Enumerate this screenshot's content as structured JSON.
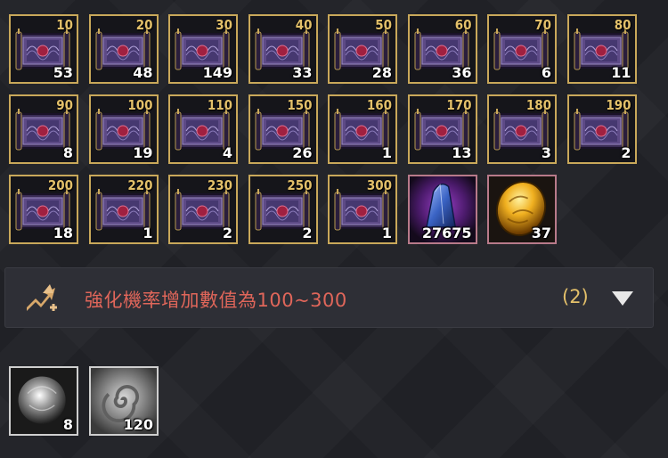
{
  "scrolls": [
    {
      "level": "10",
      "count": "53"
    },
    {
      "level": "20",
      "count": "48"
    },
    {
      "level": "30",
      "count": "149"
    },
    {
      "level": "40",
      "count": "33"
    },
    {
      "level": "50",
      "count": "28"
    },
    {
      "level": "60",
      "count": "36"
    },
    {
      "level": "70",
      "count": "6"
    },
    {
      "level": "80",
      "count": "11"
    },
    {
      "level": "90",
      "count": "8"
    },
    {
      "level": "100",
      "count": "19"
    },
    {
      "level": "110",
      "count": "4"
    },
    {
      "level": "150",
      "count": "26"
    },
    {
      "level": "160",
      "count": "1"
    },
    {
      "level": "170",
      "count": "13"
    },
    {
      "level": "180",
      "count": "3"
    },
    {
      "level": "190",
      "count": "2"
    },
    {
      "level": "200",
      "count": "18"
    },
    {
      "level": "220",
      "count": "1"
    },
    {
      "level": "230",
      "count": "2"
    },
    {
      "level": "250",
      "count": "2"
    },
    {
      "level": "300",
      "count": "1"
    }
  ],
  "materials": [
    {
      "name": "blue-crystal-icon",
      "count": "27675"
    },
    {
      "name": "golden-orb-icon",
      "count": "37"
    }
  ],
  "filter_bar": {
    "label": "強化機率增加數值為100~300",
    "count": "(2)",
    "icon": "upgrade-plus-icon"
  },
  "bottom_items": [
    {
      "name": "silver-orb-icon",
      "count": "8"
    },
    {
      "name": "swirl-stone-icon",
      "count": "120"
    }
  ],
  "colors": {
    "level": "#e3c06a",
    "label": "#e0665a",
    "border": "#c9a85a"
  }
}
